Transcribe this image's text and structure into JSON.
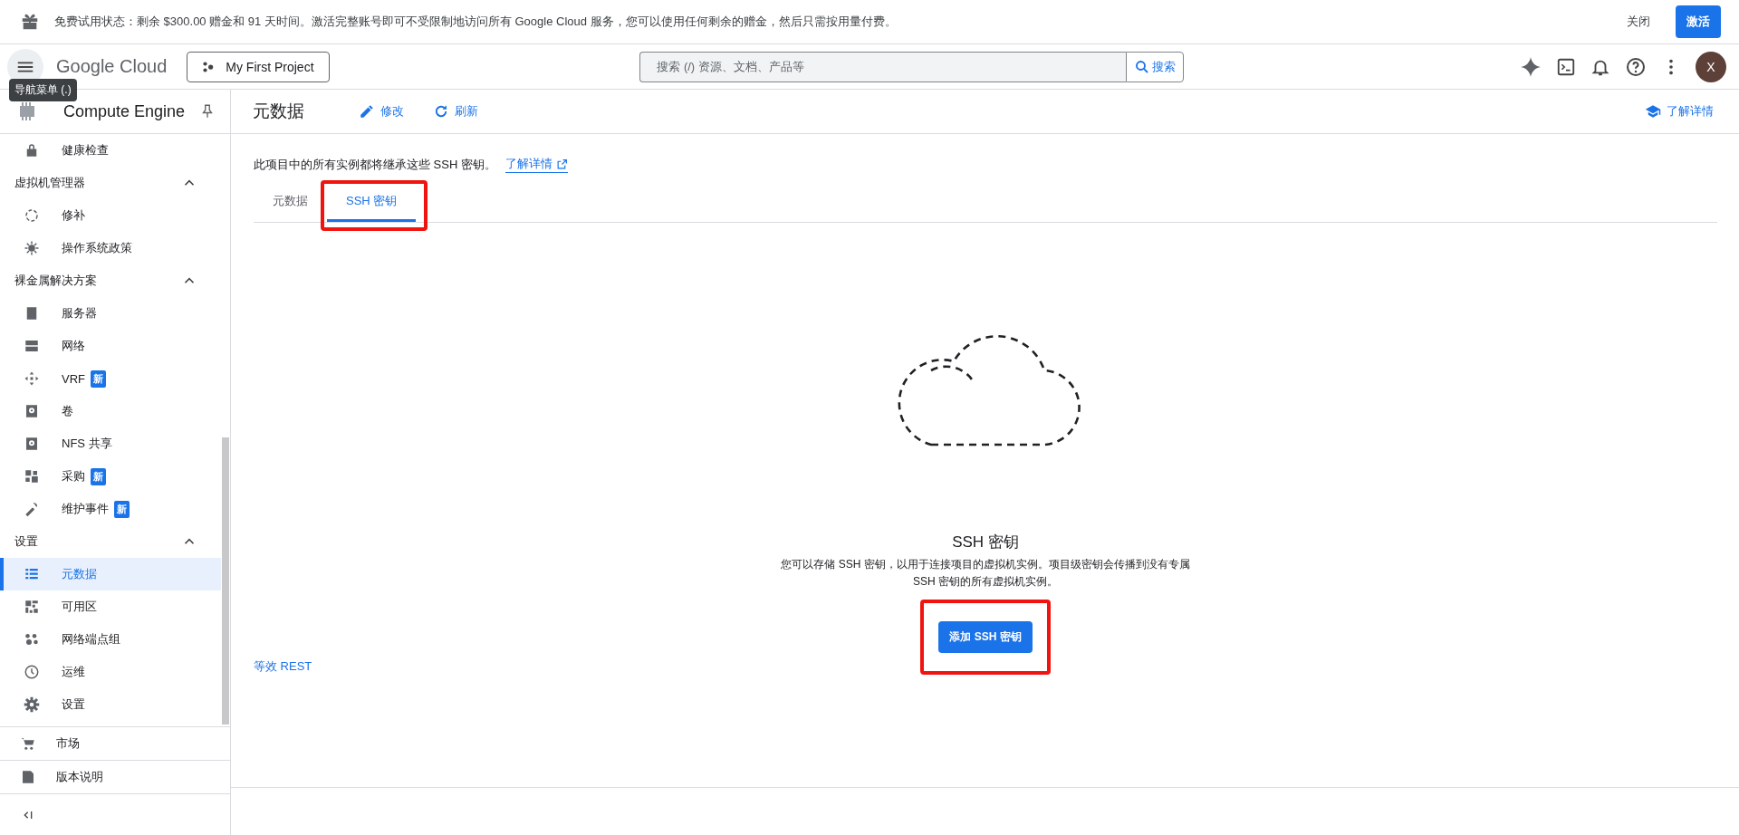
{
  "banner": {
    "text": "免费试用状态：剩余 $300.00 赠金和 91 天时间。激活完整账号即可不受限制地访问所有 Google Cloud 服务，您可以使用任何剩余的赠金，然后只需按用量付费。",
    "dismiss": "关闭",
    "activate": "激活"
  },
  "header": {
    "logo": "Google Cloud",
    "project": "My First Project",
    "search": {
      "placeholder": "搜索 (/) 资源、文档、产品等"
    },
    "search_button": "搜索",
    "avatar": "X",
    "tooltip": "导航菜单 (.)"
  },
  "sidebar": {
    "title": "Compute Engine",
    "items": [
      {
        "kind": "item",
        "label": "健康检查",
        "selected": false
      },
      {
        "kind": "header",
        "label": "虚拟机管理器",
        "expanded": true
      },
      {
        "kind": "item",
        "label": "修补",
        "selected": false
      },
      {
        "kind": "item",
        "label": "操作系统政策",
        "selected": false
      },
      {
        "kind": "header",
        "label": "裸金属解决方案",
        "expanded": true
      },
      {
        "kind": "item",
        "label": "服务器",
        "selected": false
      },
      {
        "kind": "item",
        "label": "网络",
        "selected": false
      },
      {
        "kind": "item",
        "label": "VRF",
        "badge": "新",
        "selected": false
      },
      {
        "kind": "item",
        "label": "卷",
        "selected": false
      },
      {
        "kind": "item",
        "label": "NFS 共享",
        "selected": false
      },
      {
        "kind": "item",
        "label": "采购",
        "badge": "新",
        "selected": false
      },
      {
        "kind": "item",
        "label": "维护事件",
        "badge": "新",
        "selected": false
      },
      {
        "kind": "header",
        "label": "设置",
        "expanded": true
      },
      {
        "kind": "item",
        "label": "元数据",
        "selected": true
      },
      {
        "kind": "item",
        "label": "可用区",
        "selected": false
      },
      {
        "kind": "item",
        "label": "网络端点组",
        "selected": false
      },
      {
        "kind": "item",
        "label": "运维",
        "selected": false
      },
      {
        "kind": "item",
        "label": "设置",
        "selected": false
      }
    ],
    "footer": [
      "市场",
      "版本说明"
    ]
  },
  "page": {
    "title": "元数据",
    "actions": [
      "修改",
      "刷新"
    ],
    "learn_more": "了解详情",
    "intro": "此项目中的所有实例都将继承这些 SSH 密钥。",
    "intro_link": "了解详情",
    "tabs": [
      {
        "label": "元数据",
        "selected": false
      },
      {
        "label": "SSH 密钥",
        "selected": true
      }
    ],
    "empty": {
      "title": "SSH 密钥",
      "description": "您可以存储 SSH 密钥，以用于连接项目的虚拟机实例。项目级密钥会传播到没有专属 SSH 密钥的所有虚拟机实例。",
      "button": "添加 SSH 密钥"
    },
    "rest_link": "等效 REST"
  }
}
